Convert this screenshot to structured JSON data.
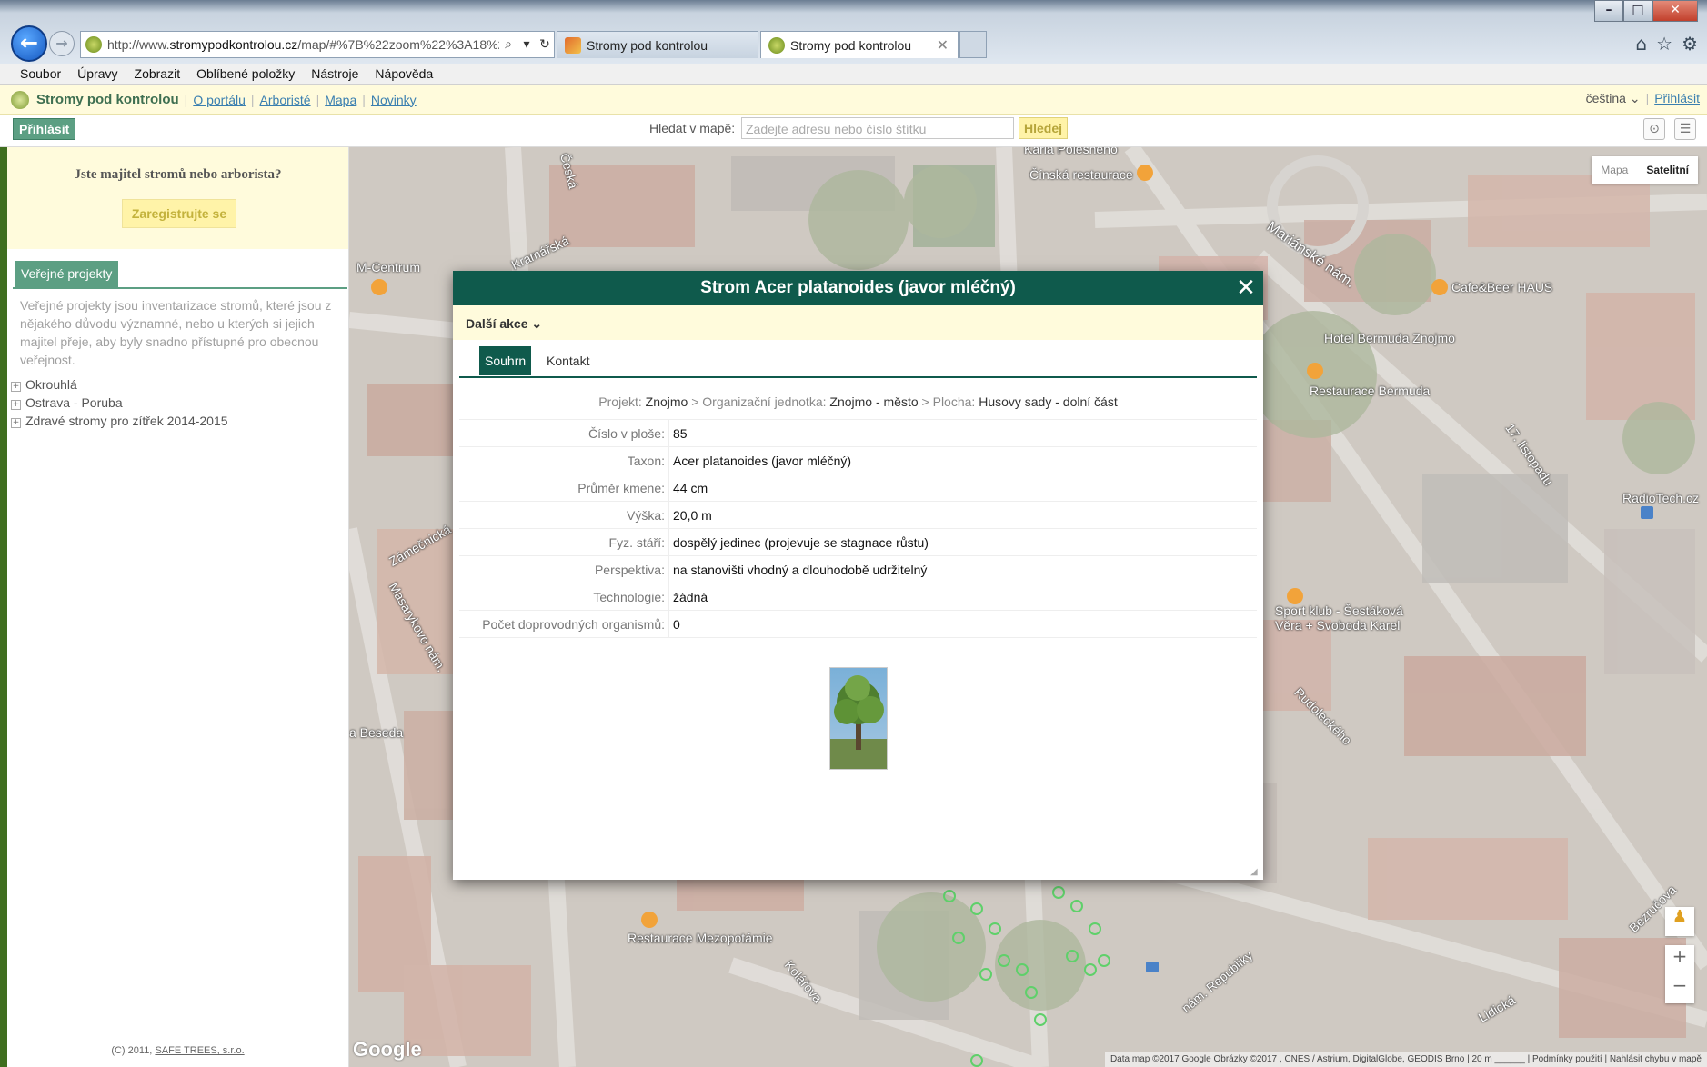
{
  "browser": {
    "url_prefix": "http://www.",
    "url_domain": "stromypodkontrolou.cz",
    "url_rest": "/map/#%7B%22zoom%22%3A18%2C",
    "tabs": [
      {
        "label": "Stromy pod kontrolou"
      },
      {
        "label": "Stromy pod kontrolou"
      }
    ],
    "menu": [
      "Soubor",
      "Úpravy",
      "Zobrazit",
      "Oblíbené položky",
      "Nástroje",
      "Nápověda"
    ]
  },
  "site": {
    "brand": "Stromy pod kontrolou",
    "nav": [
      "O portálu",
      "Arboristé",
      "Mapa",
      "Novinky"
    ],
    "language": "čeština",
    "login_top": "Přihlásit",
    "login_button": "Přihlásit",
    "search_label": "Hledat v mapě:",
    "search_placeholder": "Zadejte adresu nebo číslo štítku",
    "search_button": "Hledej"
  },
  "sidebar": {
    "promo_title": "Jste majitel stromů nebo arborista?",
    "register_button": "Zaregistrujte se",
    "projects_tab": "Veřejné projekty",
    "projects_desc": "Veřejné projekty jsou inventarizace stromů, které jsou z nějakého důvodu významné, nebo u kterých si jejich majitel přeje, aby byly snadno přístupné pro obecnou veřejnost.",
    "projects": [
      "Okrouhlá",
      "Ostrava - Poruba",
      "Zdravé stromy pro zítřek 2014-2015"
    ],
    "copyright_prefix": "(C) 2011,",
    "copyright_link": "SAFE TREES, s.r.o."
  },
  "map": {
    "type_buttons": [
      "Mapa",
      "Satelitní"
    ],
    "labels": {
      "pol": "Karla Polesného",
      "cin": "Čínská restaurace",
      "mcentrum": "M-Centrum",
      "kram": "Kramářská",
      "ceska": "Česká",
      "mar": "Mariánské nám.",
      "cafe": "Cafe&Beer HAUS",
      "hotel": "Hotel Bermuda Znojmo",
      "restb": "Restaurace Bermuda",
      "list": "17. listopadu",
      "radio": "RadioTech.cz",
      "zamec": "Zámečnická",
      "masar": "Masarykovo nám.",
      "sport1": "Sport klub - Šestáková",
      "sport2": "Věra + Svoboda Karel",
      "rudo": "Rudoleckého",
      "beseda": "a Beseda",
      "mezo": "Restaurace Mezopotámie",
      "kolar": "Kolářova",
      "repub": "nám. Republiky",
      "lidicka": "Lidická",
      "bez": "Bezručova"
    },
    "google": "Google",
    "credits": "Data map ©2017 Google Obrázky ©2017 , CNES / Astrium, DigitalGlobe, GEODIS Brno  |  20 m ______  |  Podmínky použití  |  Nahlásit chybu v mapě"
  },
  "modal": {
    "title": "Strom Acer platanoides (javor mléčný)",
    "actions": "Další akce",
    "tabs": [
      "Souhrn",
      "Kontakt"
    ],
    "breadcrumb": {
      "projekt_label": "Projekt:",
      "projekt": "Znojmo",
      "org_label": "Organizační jednotka:",
      "org": "Znojmo - město",
      "plocha_label": "Plocha:",
      "plocha": "Husovy sady - dolní část"
    },
    "properties": [
      {
        "label": "Číslo v ploše:",
        "value": "85"
      },
      {
        "label": "Taxon:",
        "value": "Acer platanoides (javor mléčný)"
      },
      {
        "label": "Průměr kmene:",
        "value": "44 cm"
      },
      {
        "label": "Výška:",
        "value": "20,0 m"
      },
      {
        "label": "Fyz. stáří:",
        "value": "dospělý jedinec (projevuje se stagnace růstu)"
      },
      {
        "label": "Perspektiva:",
        "value": "na stanovišti vhodný a dlouhodobě udržitelný"
      },
      {
        "label": "Technologie:",
        "value": "žádná"
      },
      {
        "label": "Počet doprovodných organismů:",
        "value": "0"
      }
    ]
  }
}
